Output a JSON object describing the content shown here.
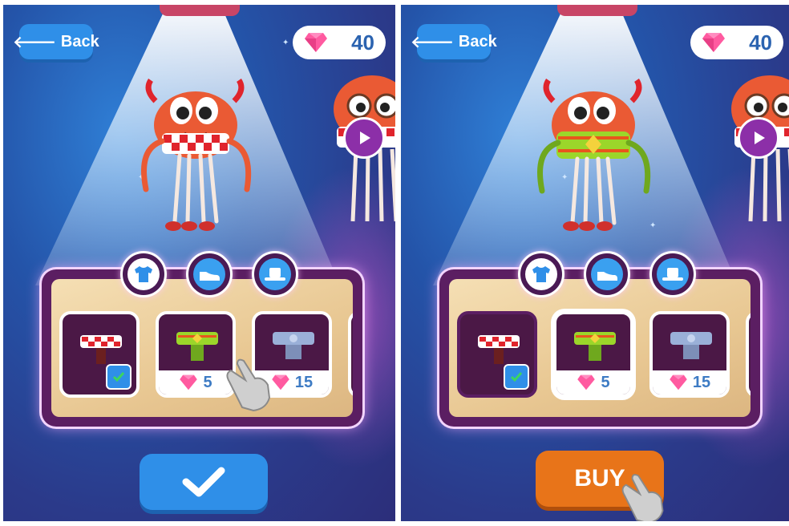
{
  "screens": [
    {
      "id": "before-select",
      "back_label": "Back",
      "gems": "40",
      "tabs": [
        "shirt-icon",
        "shoe-icon",
        "hat-icon"
      ],
      "active_tab": 0,
      "items": [
        {
          "name": "checkered-scarf",
          "price": "",
          "selected": true
        },
        {
          "name": "green-scarf",
          "price": "5",
          "selected": false
        },
        {
          "name": "blue-scarf",
          "price": "15",
          "selected": false
        }
      ],
      "action": "confirm"
    },
    {
      "id": "after-select",
      "back_label": "Back",
      "gems": "40",
      "tabs": [
        "shirt-icon",
        "shoe-icon",
        "hat-icon"
      ],
      "active_tab": 0,
      "items": [
        {
          "name": "checkered-scarf",
          "price": "",
          "selected": true
        },
        {
          "name": "green-scarf",
          "price": "5",
          "selected": false
        },
        {
          "name": "blue-scarf",
          "price": "15",
          "selected": false
        }
      ],
      "action": "buy",
      "buy_label": "BUY"
    }
  ],
  "colors": {
    "accent_blue": "#2f8fe8",
    "buy_orange": "#e87419",
    "gem_pink": "#ff5aa0",
    "tray_purple": "#5b1e62"
  }
}
